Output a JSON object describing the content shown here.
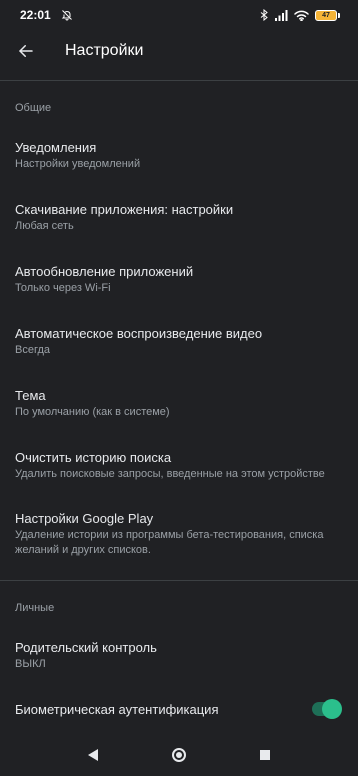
{
  "status_bar": {
    "time": "22:01",
    "battery_level": "47",
    "icons": [
      "mute-notifications-icon",
      "bluetooth-icon",
      "signal-icon",
      "wifi-icon",
      "battery-icon"
    ]
  },
  "app_bar": {
    "title": "Настройки",
    "back_icon": "arrow-back-icon"
  },
  "sections": {
    "general": {
      "header": "Общие",
      "items": [
        {
          "title": "Уведомления",
          "subtitle": "Настройки уведомлений"
        },
        {
          "title": "Скачивание приложения: настройки",
          "subtitle": "Любая сеть"
        },
        {
          "title": "Автообновление приложений",
          "subtitle": "Только через Wi-Fi"
        },
        {
          "title": "Автоматическое воспроизведение видео",
          "subtitle": "Всегда"
        },
        {
          "title": "Тема",
          "subtitle": "По умолчанию (как в системе)"
        },
        {
          "title": "Очистить историю поиска",
          "subtitle": "Удалить поисковые запросы, введенные на этом устройстве"
        },
        {
          "title": "Настройки Google Play",
          "subtitle": "Удаление истории из программы бета-тестирования, списка желаний и других списков."
        }
      ]
    },
    "personal": {
      "header": "Личные",
      "items": [
        {
          "title": "Родительский контроль",
          "subtitle": "ВЫКЛ"
        },
        {
          "title": "Биометрическая аутентификация",
          "toggle_on": true
        }
      ]
    }
  },
  "nav_bar": {
    "icons": [
      "nav-back-icon",
      "nav-home-icon",
      "nav-recents-icon"
    ]
  },
  "colors": {
    "background": "#202124",
    "text_primary": "#e8eaed",
    "text_secondary": "#9aa0a6",
    "toggle_accent": "#2bbf8c",
    "battery": "#f5b437"
  }
}
